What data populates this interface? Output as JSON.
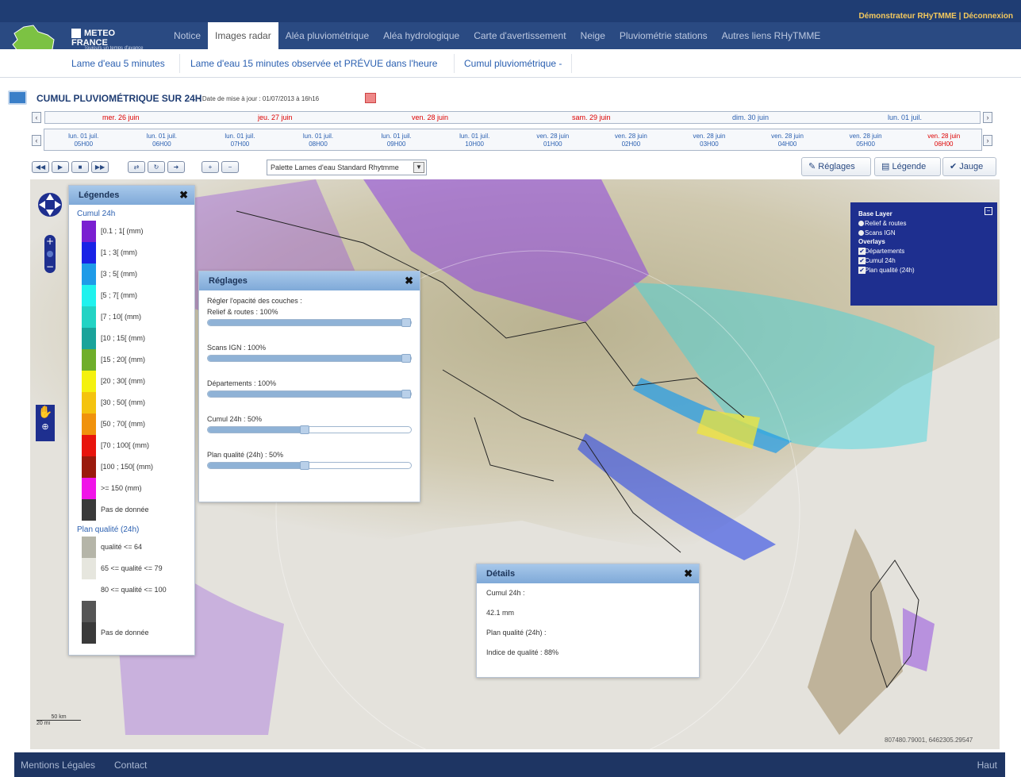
{
  "topbar": {
    "user_text": "Démonstrateur RHyTMME | Déconnexion"
  },
  "brand": {
    "name": "METEO FRANCE",
    "tagline": "Toujours un temps d'avance"
  },
  "nav_tabs": [
    "Notice",
    "Images radar",
    "Aléa pluviométrique",
    "Aléa hydrologique",
    "Carte d'avertissement",
    "Neige",
    "Pluviométrie stations",
    "Autres liens RHyTMME"
  ],
  "active_tab": "Images radar",
  "subnav": [
    "Lame d'eau 5 minutes",
    "Lame d'eau 15 minutes observée et PRÉVUE dans l'heure",
    "Cumul pluviométrique -"
  ],
  "panel": {
    "title": "CUMUL PLUVIOMÉTRIQUE SUR 24H",
    "update": "- Date de mise à jour : 01/07/2013 à 16h16"
  },
  "days": [
    "mer. 26 juin",
    "jeu. 27 juin",
    "ven. 28 juin",
    "sam. 29 juin",
    "dim. 30 juin",
    "lun. 01 juil."
  ],
  "hours": [
    {
      "d": "lun. 01 juil.",
      "h": "05H00"
    },
    {
      "d": "lun. 01 juil.",
      "h": "06H00"
    },
    {
      "d": "lun. 01 juil.",
      "h": "07H00"
    },
    {
      "d": "lun. 01 juil.",
      "h": "08H00"
    },
    {
      "d": "lun. 01 juil.",
      "h": "09H00"
    },
    {
      "d": "lun. 01 juil.",
      "h": "10H00"
    },
    {
      "d": "ven. 28 juin",
      "h": "01H00"
    },
    {
      "d": "ven. 28 juin",
      "h": "02H00"
    },
    {
      "d": "ven. 28 juin",
      "h": "03H00"
    },
    {
      "d": "ven. 28 juin",
      "h": "04H00"
    },
    {
      "d": "ven. 28 juin",
      "h": "05H00"
    },
    {
      "d": "ven. 28 juin",
      "h": "06H00"
    }
  ],
  "toolbar": {
    "palette": "Palette Lames d'eau Standard Rhytmme",
    "reglages": "Réglages",
    "legende": "Légende",
    "jauge": "Jauge"
  },
  "legend": {
    "title": "Légendes",
    "cumul_title": "Cumul 24h",
    "cumul": [
      {
        "label": "[0.1 ; 1[ (mm)",
        "color": "#7a1fd1"
      },
      {
        "label": "[1 ; 3[ (mm)",
        "color": "#1a22e6"
      },
      {
        "label": "[3 ; 5[ (mm)",
        "color": "#1e9be8"
      },
      {
        "label": "[5 ; 7[ (mm)",
        "color": "#1ff2ee"
      },
      {
        "label": "[7 ; 10[ (mm)",
        "color": "#22d3c4"
      },
      {
        "label": "[10 ; 15[ (mm)",
        "color": "#1aa39a"
      },
      {
        "label": "[15 ; 20[ (mm)",
        "color": "#6fae2a"
      },
      {
        "label": "[20 ; 30[ (mm)",
        "color": "#f4f10f"
      },
      {
        "label": "[30 ; 50[ (mm)",
        "color": "#f4c30f"
      },
      {
        "label": "[50 ; 70[ (mm)",
        "color": "#f0920c"
      },
      {
        "label": "[70 ; 100[ (mm)",
        "color": "#e8140c"
      },
      {
        "label": "[100 ; 150[ (mm)",
        "color": "#9a1a0c"
      },
      {
        "label": ">= 150 (mm)",
        "color": "#f014e8"
      },
      {
        "label": "Pas de donnée",
        "color": "#3a3a3a"
      }
    ],
    "qual_title": "Plan qualité (24h)",
    "qual": [
      {
        "label": "qualité <= 64",
        "color": "#b5b5a8"
      },
      {
        "label": "65 <= qualité <= 79",
        "color": "#e6e6de"
      },
      {
        "label": "80 <= qualité <= 100",
        "color": "#ffffff"
      },
      {
        "label": "",
        "color": "#555555"
      },
      {
        "label": "Pas de donnée",
        "color": "#3a3a3a"
      }
    ]
  },
  "reglages": {
    "title": "Réglages",
    "intro": "Régler l'opacité des couches :",
    "sliders": [
      {
        "name": "Relief & routes : 100%",
        "value": 100
      },
      {
        "name": "Scans IGN : 100%",
        "value": 100
      },
      {
        "name": "Départements : 100%",
        "value": 100
      },
      {
        "name": "Cumul 24h : 50%",
        "value": 50
      },
      {
        "name": "Plan qualité (24h) : 50%",
        "value": 50
      }
    ]
  },
  "layers": {
    "base_title": "Base Layer",
    "base": [
      "Relief & routes",
      "Scans IGN"
    ],
    "overlays_title": "Overlays",
    "overlays": [
      "Départements",
      "Cumul 24h",
      "Plan qualité (24h)"
    ]
  },
  "details": {
    "title": "Détails",
    "lines": [
      "Cumul 24h :",
      "42.1 mm",
      "Plan qualité (24h) :",
      "Indice de qualité : 88%"
    ]
  },
  "map": {
    "scale_km": "50 km",
    "scale_mi": "20 mi",
    "coords": "807480.79001, 6462305.29547"
  },
  "footer": {
    "mentions": "Mentions Légales",
    "contact": "Contact",
    "top": "Haut"
  }
}
